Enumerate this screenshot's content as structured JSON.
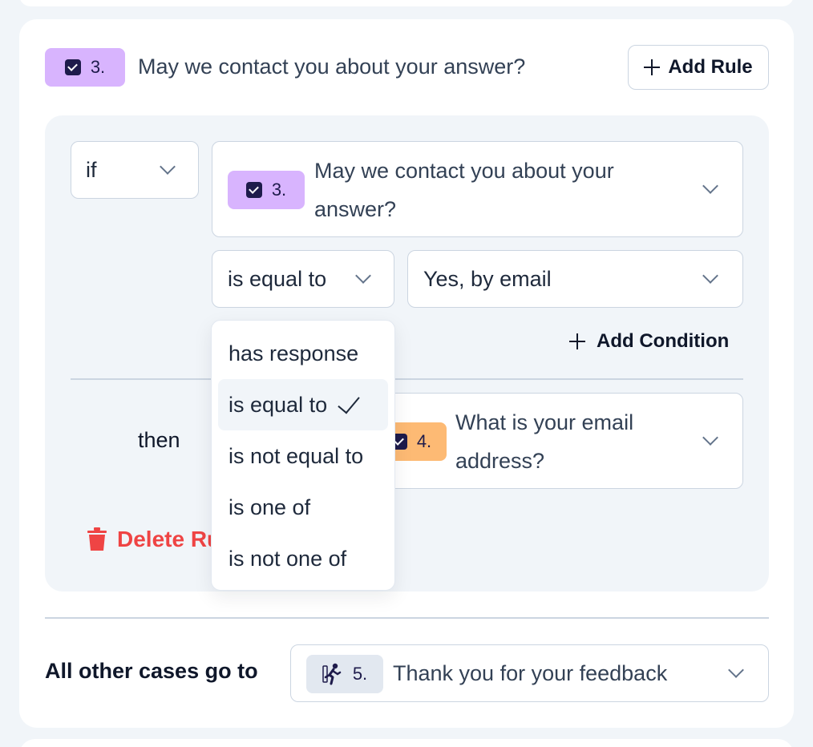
{
  "question": {
    "number": "3.",
    "title": "May we contact you about your answer?"
  },
  "add_rule_label": "Add Rule",
  "rule": {
    "if_label": "if",
    "condition_question": {
      "number": "3.",
      "title": "May we contact you about your answer?"
    },
    "operator": "is equal to",
    "value": "Yes, by email",
    "add_condition_label": "Add Condition",
    "then_label": "then",
    "target_question": {
      "number": "4.",
      "title": "What is your email address?"
    },
    "delete_label": "Delete Ru"
  },
  "operator_menu": {
    "items": [
      "has response",
      "is equal to",
      "is not equal to",
      "is one of",
      "is not one of"
    ],
    "selected": "is equal to"
  },
  "fallback": {
    "label": "All other cases go to",
    "target": {
      "number": "5.",
      "title": "Thank you for your feedback"
    }
  },
  "colors": {
    "badge_purple": "#d8b4fe",
    "badge_orange": "#fdba74",
    "delete_red": "#ef4444"
  },
  "icons": {
    "badge": "checkbox-icon",
    "end": "running-person-icon",
    "delete": "trash-icon"
  }
}
